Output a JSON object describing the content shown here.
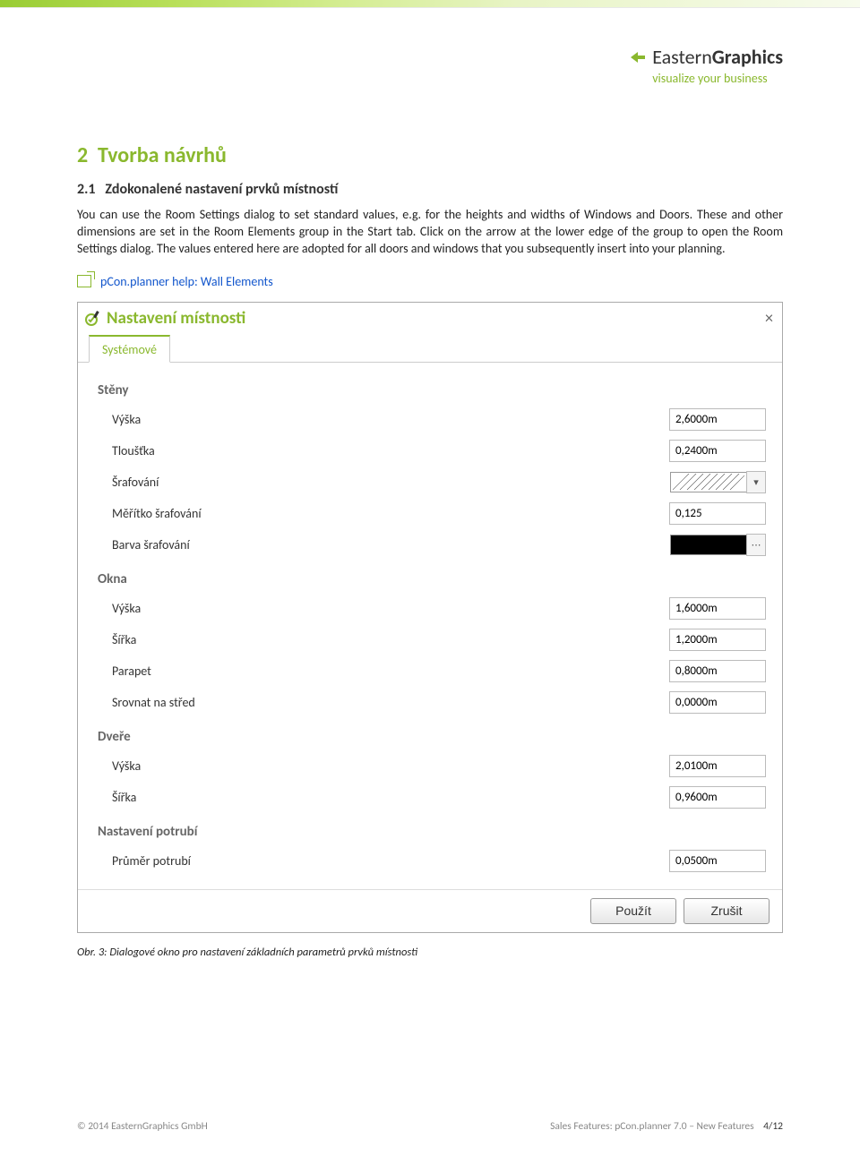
{
  "logo": {
    "brand_prefix": "Eastern",
    "brand_suffix": "Graphics",
    "tagline": "visualize your business"
  },
  "section": {
    "number": "2",
    "title": "Tvorba návrhů",
    "sub_number": "2.1",
    "sub_title": "Zdokonalené nastavení prvků místností",
    "para": "You can use the Room Settings dialog to set standard values, e.g. for the heights and widths of Windows and Doors. These and other dimensions are set in the Room Elements group in the Start tab. Click on the arrow at the lower edge of the group to open the Room Settings dialog. The values entered here are adopted for all doors and windows that you subsequently insert into your planning."
  },
  "help_link": {
    "label": "pCon.planner help: Wall Elements"
  },
  "dialog": {
    "title": "Nastavení místnosti",
    "tab_label": "Systémové",
    "groups": {
      "walls": {
        "title": "Stěny",
        "height_label": "Výška",
        "height_value": "2,6000m",
        "thickness_label": "Tloušťka",
        "thickness_value": "0,2400m",
        "hatch_label": "Šrafování",
        "hatch_scale_label": "Měřítko šrafování",
        "hatch_scale_value": "0,125",
        "hatch_color_label": "Barva šrafování"
      },
      "windows": {
        "title": "Okna",
        "height_label": "Výška",
        "height_value": "1,6000m",
        "width_label": "Šířka",
        "width_value": "1,2000m",
        "parapet_label": "Parapet",
        "parapet_value": "0,8000m",
        "center_label": "Srovnat na střed",
        "center_value": "0,0000m"
      },
      "doors": {
        "title": "Dveře",
        "height_label": "Výška",
        "height_value": "2,0100m",
        "width_label": "Šířka",
        "width_value": "0,9600m"
      },
      "pipes": {
        "title": "Nastavení potrubí",
        "diameter_label": "Průměr potrubí",
        "diameter_value": "0,0500m"
      }
    },
    "buttons": {
      "apply": "Použít",
      "cancel": "Zrušit"
    }
  },
  "caption": "Obr. 3: Dialogové okno pro nastavení základních parametrů prvků místnosti",
  "footer": {
    "left": "© 2014 EasternGraphics GmbH",
    "right_text": "Sales Features: pCon.planner 7.0 – New Features",
    "page": "4/12"
  }
}
